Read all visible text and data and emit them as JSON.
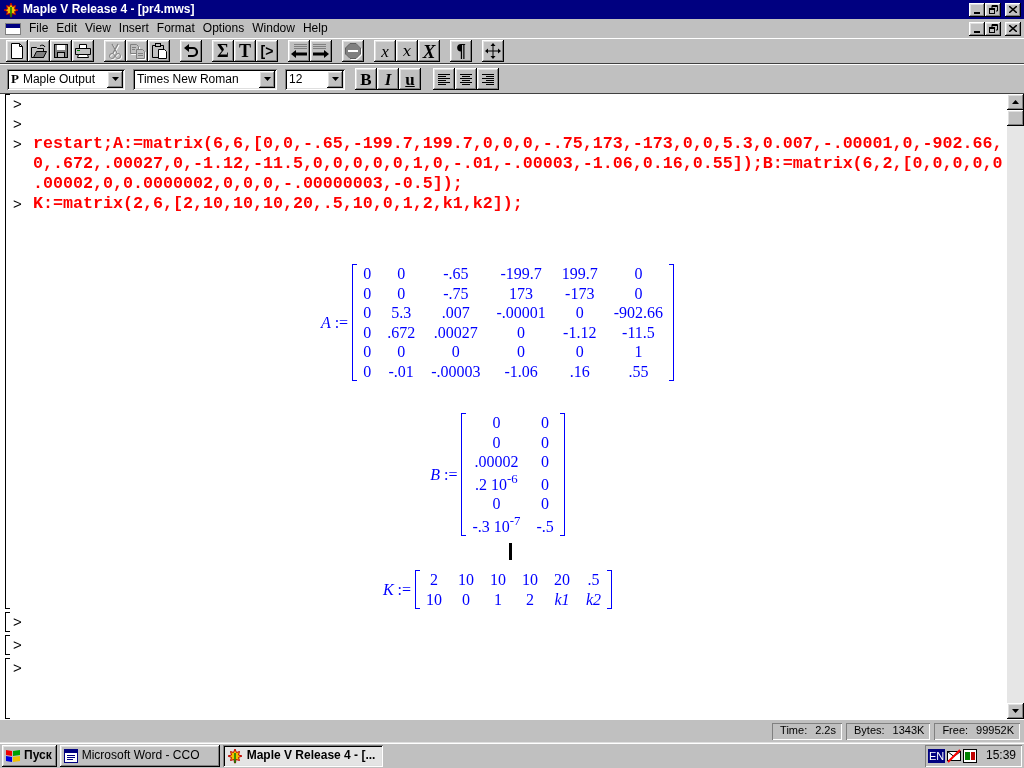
{
  "window": {
    "title": "Maple V Release 4 - [pr4.mws]"
  },
  "menu": [
    "File",
    "Edit",
    "View",
    "Insert",
    "Format",
    "Options",
    "Window",
    "Help"
  ],
  "toolbar": [
    [
      {
        "kind": "icon",
        "disabled": false
      },
      {
        "kind": "icon",
        "disabled": false
      },
      {
        "kind": "icon",
        "disabled": false
      },
      {
        "kind": "icon",
        "disabled": false
      }
    ],
    [
      {
        "kind": "icon",
        "disabled": true
      },
      {
        "kind": "icon",
        "disabled": true
      },
      {
        "kind": "icon",
        "disabled": false
      }
    ],
    [
      {
        "kind": "icon",
        "disabled": false
      }
    ],
    [
      {
        "kind": "glyph",
        "label": "Σ",
        "disabled": false
      },
      {
        "kind": "glyph",
        "label": "T",
        "disabled": false
      },
      {
        "kind": "glyph",
        "label": "[>",
        "disabled": false
      }
    ],
    [
      {
        "kind": "icon",
        "disabled": false
      },
      {
        "kind": "icon",
        "disabled": false
      }
    ],
    [
      {
        "kind": "icon",
        "disabled": true
      }
    ],
    [
      {
        "kind": "glyph",
        "label": "x",
        "disabled": false
      },
      {
        "kind": "glyph",
        "label": "x",
        "disabled": false
      },
      {
        "kind": "glyph",
        "label": "X",
        "disabled": false
      }
    ],
    [
      {
        "kind": "glyph",
        "label": "¶",
        "disabled": false
      }
    ],
    [
      {
        "kind": "icon",
        "disabled": false
      }
    ]
  ],
  "format_bar": {
    "style": {
      "marker": "P",
      "value": "Maple Output"
    },
    "font": "Times New Roman",
    "size": "12",
    "text_buttons": [
      "B",
      "I",
      "u"
    ]
  },
  "worksheet": {
    "groups": [
      {
        "lines": [
          {
            "prompt": ">"
          },
          {
            "prompt": ">"
          },
          {
            "prompt": ">",
            "input": "restart;A:=matrix(6,6,[0,0,-.65,-199.7,199.7,0,0,0,-.75,173,-173,0,0,5.3,0.007,-.00001,0,-902.66,0,.672,.00027,0,-1.12,-11.5,0,0,0,0,0,1,0,-.01,-.00003,-1.06,0.16,0.55]);B:=matrix(6,2,[0,0,0,0,0.00002,0,0.0000002,0,0,0,-.00000003,-0.5]);"
          },
          {
            "prompt": ">",
            "input": "K:=matrix(2,6,[2,10,10,10,20,.5,10,0,1,2,k1,k2]);"
          }
        ],
        "outputs": [
          {
            "label": "*A* :=",
            "rows": [
              [
                "0",
                "0",
                "-.65",
                "-199.7",
                "199.7",
                "0"
              ],
              [
                "0",
                "0",
                "-.75",
                "173",
                "-173",
                "0"
              ],
              [
                "0",
                "5.3",
                ".007",
                "-.00001",
                "0",
                "-902.66"
              ],
              [
                "0",
                ".672",
                ".00027",
                "0",
                "-1.12",
                "-11.5"
              ],
              [
                "0",
                "0",
                "0",
                "0",
                "0",
                "1"
              ],
              [
                "0",
                "-.01",
                "-.00003",
                "-1.06",
                ".16",
                ".55"
              ]
            ]
          },
          {
            "label": "*B* :=",
            "rows": [
              [
                "0",
                "0"
              ],
              [
                "0",
                "0"
              ],
              [
                ".00002",
                "0"
              ],
              [
                ".2 10$^{-6}$",
                "0"
              ],
              [
                "0",
                "0"
              ],
              [
                "-.3 10$^{-7}$",
                "-.5"
              ]
            ]
          },
          {
            "label": "*K* :=",
            "rows": [
              [
                {
                  "text": "2",
                  "kind": "number"
                },
                {
                  "text": "10",
                  "kind": "number"
                },
                {
                  "text": "10",
                  "kind": "number"
                },
                {
                  "text": "10",
                  "kind": "number"
                },
                {
                  "text": "20",
                  "kind": "number"
                },
                {
                  "text": ".5",
                  "kind": "number"
                }
              ],
              [
                {
                  "text": "10",
                  "kind": "number"
                },
                {
                  "text": "0",
                  "kind": "number"
                },
                {
                  "text": "1",
                  "kind": "number"
                },
                {
                  "text": "2",
                  "kind": "number"
                },
                {
                  "text": "k1",
                  "kind": "symbol"
                },
                {
                  "text": "k2",
                  "kind": "symbol"
                }
              ]
            ]
          }
        ]
      },
      {
        "lines": [
          {
            "prompt": ">"
          }
        ]
      },
      {
        "lines": [
          {
            "prompt": ">"
          }
        ]
      },
      {
        "lines": [
          {
            "prompt": ">"
          }
        ]
      }
    ]
  },
  "status_bar": [
    {
      "label": "Time:",
      "value": "2.2s"
    },
    {
      "label": "Bytes:",
      "value": "1343K"
    },
    {
      "label": "Free:",
      "value": "99952K"
    }
  ],
  "taskbar": {
    "start": "Пуск",
    "tasks": [
      {
        "label": "Microsoft Word - CCO",
        "selected": false
      },
      {
        "label": "Maple V Release 4 - [...",
        "selected": true
      }
    ],
    "tray": {
      "language": "EN",
      "clock": "15:39"
    }
  }
}
